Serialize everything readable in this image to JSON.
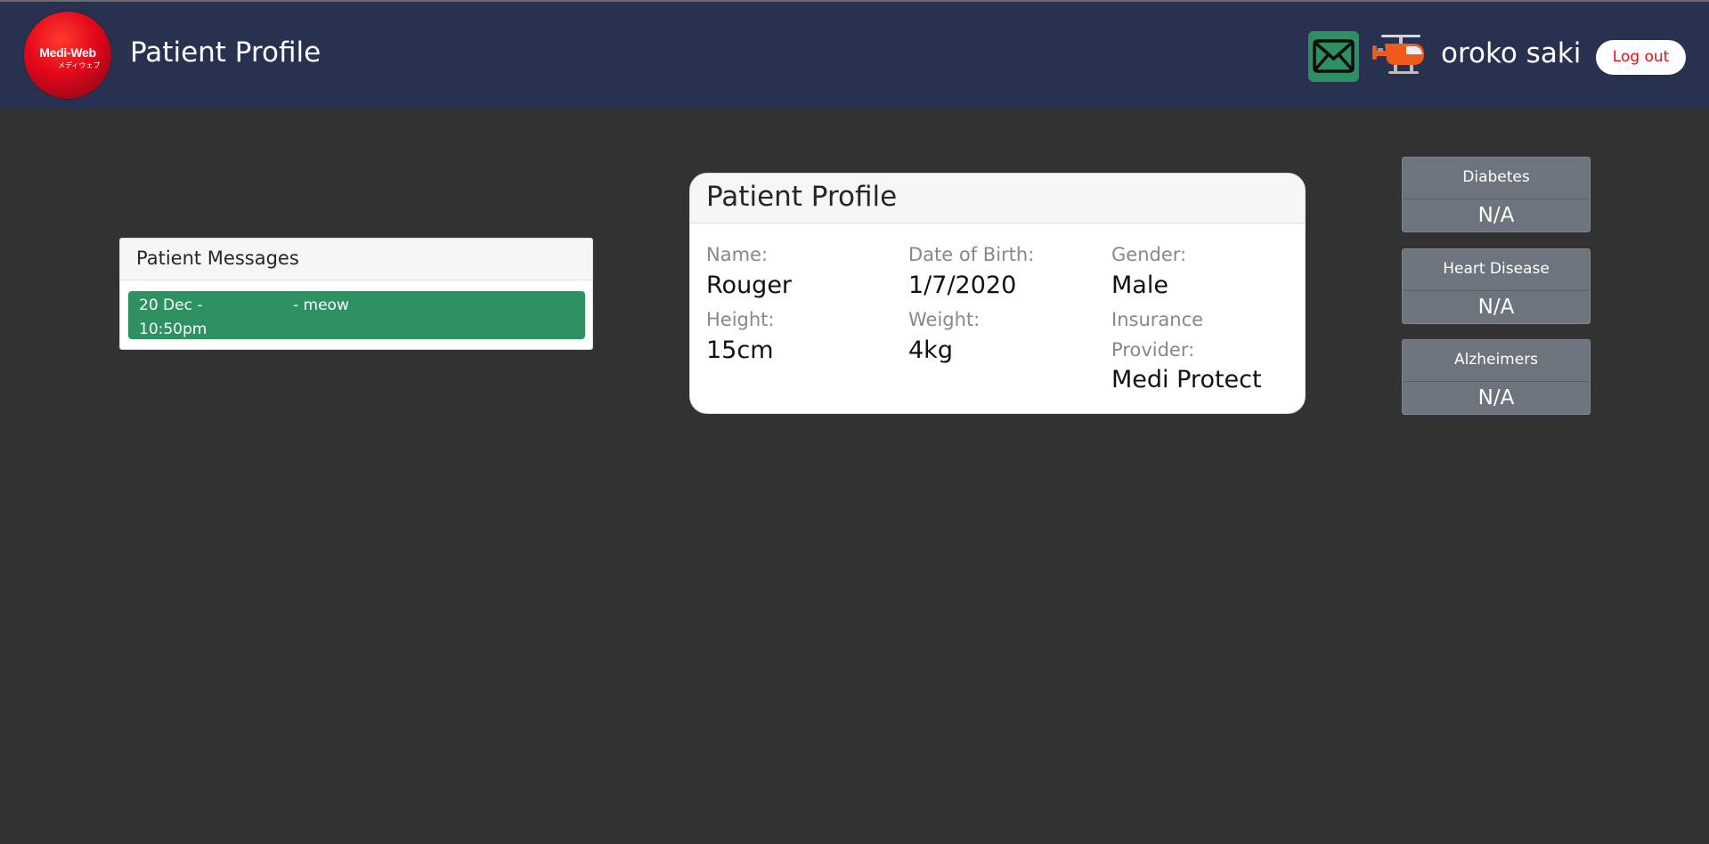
{
  "app": {
    "logo_text": "Medi-Web",
    "logo_subtext": "メディウェブ",
    "nav_title": "Patient Profile",
    "user_name": "oroko saki",
    "logout_label": "Log out",
    "mail_icon": "mail-icon",
    "helicopter_icon": "helicopter-icon"
  },
  "messages": {
    "title": "Patient Messages",
    "items": [
      {
        "date": "20 Dec - 10:50pm",
        "text": "- meow"
      }
    ]
  },
  "profile": {
    "title": "Patient Profile",
    "name_label": "Name:",
    "name": "Rouger",
    "dob_label": "Date of Birth:",
    "dob": "1/7/2020",
    "gender_label": "Gender:",
    "gender": "Male",
    "height_label": "Height:",
    "height": "15cm",
    "weight_label": "Weight:",
    "weight": "4kg",
    "insurance_label": "Insurance Provider:",
    "insurance": "Medi Protect"
  },
  "conditions": [
    {
      "name": "Diabetes",
      "value": "N/A"
    },
    {
      "name": "Heart Disease",
      "value": "N/A"
    },
    {
      "name": "Alzheimers",
      "value": "N/A"
    }
  ],
  "colors": {
    "navbar": "#283150",
    "background": "#323232",
    "message_green": "#2d9162",
    "logout_text": "#e00e14"
  }
}
